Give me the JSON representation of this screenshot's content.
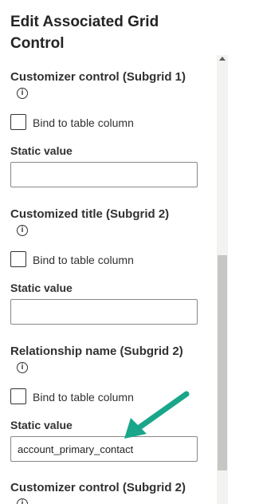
{
  "panel": {
    "title": "Edit Associated Grid Control",
    "sections": [
      {
        "heading": "Customizer control (Subgrid 1)",
        "info_icon": "info-icon",
        "checkbox_label": "Bind to table column",
        "checked": false,
        "field_label": "Static value",
        "field_value": ""
      },
      {
        "heading": "Customized title (Subgrid 2)",
        "info_icon": "info-icon",
        "checkbox_label": "Bind to table column",
        "checked": false,
        "field_label": "Static value",
        "field_value": ""
      },
      {
        "heading": "Relationship name (Subgrid 2)",
        "info_icon": "info-icon",
        "checkbox_label": "Bind to table column",
        "checked": false,
        "field_label": "Static value",
        "field_value": "account_primary_contact"
      },
      {
        "heading": "Customizer control (Subgrid 2)",
        "info_icon": "info-icon"
      }
    ]
  },
  "annotation": {
    "arrow_color": "#1aa68a"
  },
  "colors": {
    "text": "#242424",
    "border": "#8a8886",
    "scroll_track": "#f3f2f1",
    "scroll_thumb": "#c8c6c4"
  }
}
